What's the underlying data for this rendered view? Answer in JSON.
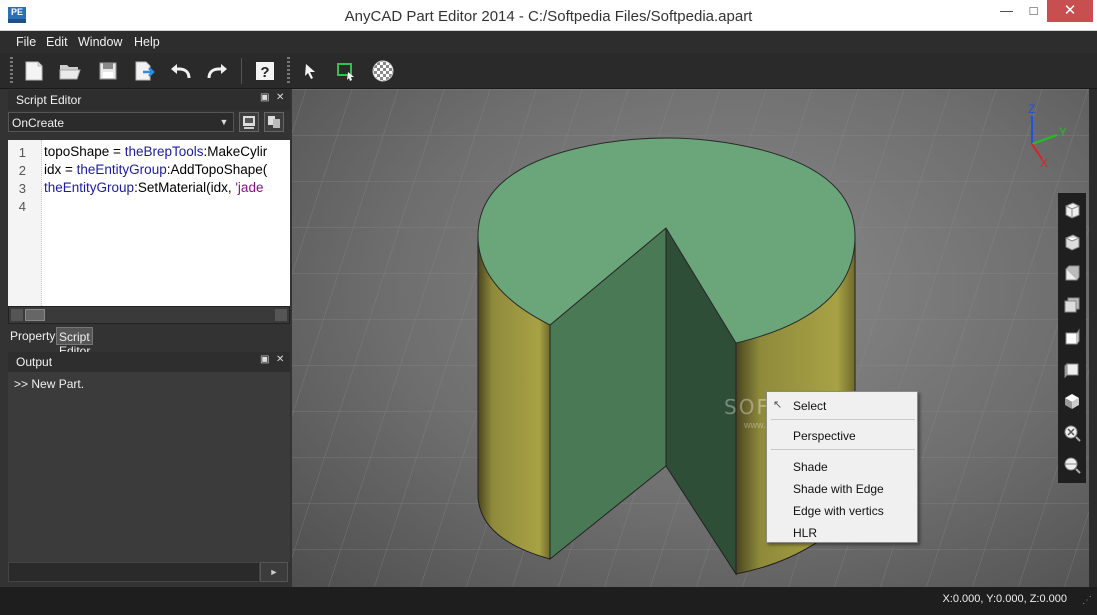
{
  "window": {
    "title": "AnyCAD Part Editor 2014 - C:/Softpedia Files/Softpedia.apart",
    "icon_text": "PE",
    "minimize_glyph": "—",
    "maximize_glyph": "□",
    "close_glyph": "✕"
  },
  "menu": [
    "File",
    "Edit",
    "Window",
    "Help"
  ],
  "toolbar": {
    "items": [
      "new-icon",
      "open-icon",
      "save-icon",
      "export-icon",
      "undo-icon",
      "redo-icon",
      "help-icon",
      "select-pointer-icon",
      "rect-select-icon",
      "material-sphere-icon"
    ]
  },
  "script_editor": {
    "title": "Script Editor",
    "event_value": "OnCreate",
    "line_numbers": [
      "1",
      "2",
      "3",
      "4"
    ],
    "lines": [
      [
        "topoShape = ",
        "theBrepTools",
        ":MakeCylir",
        ""
      ],
      [
        "idx = ",
        "theEntityGroup",
        ":AddTopoShape(",
        ""
      ],
      [
        "",
        "theEntityGroup",
        ":SetMaterial(idx, ",
        "'jade"
      ],
      [
        "",
        "",
        "",
        ""
      ]
    ]
  },
  "tabs": [
    "Property",
    "Script Editor"
  ],
  "output": {
    "title": "Output",
    "lines": [
      ">> New Part."
    ]
  },
  "viewport": {
    "top_color": "#6aa67a",
    "side_color": "#8e8a3a",
    "cut_color": "#4a7a55",
    "axis_labels": [
      "Z",
      "Y",
      "X"
    ],
    "axis_colors": {
      "x": "#e02020",
      "y": "#20c020",
      "z": "#2050e0"
    }
  },
  "context_menu": {
    "items": [
      "Select",
      "Perspective",
      "Shade",
      "Shade with Edge",
      "Edge with vertics",
      "HLR"
    ]
  },
  "watermark": {
    "main": "SOFTPEDIA",
    "sub": "www.softpedia.com"
  },
  "status": {
    "coords": "X:0.000, Y:0.000, Z:0.000"
  }
}
